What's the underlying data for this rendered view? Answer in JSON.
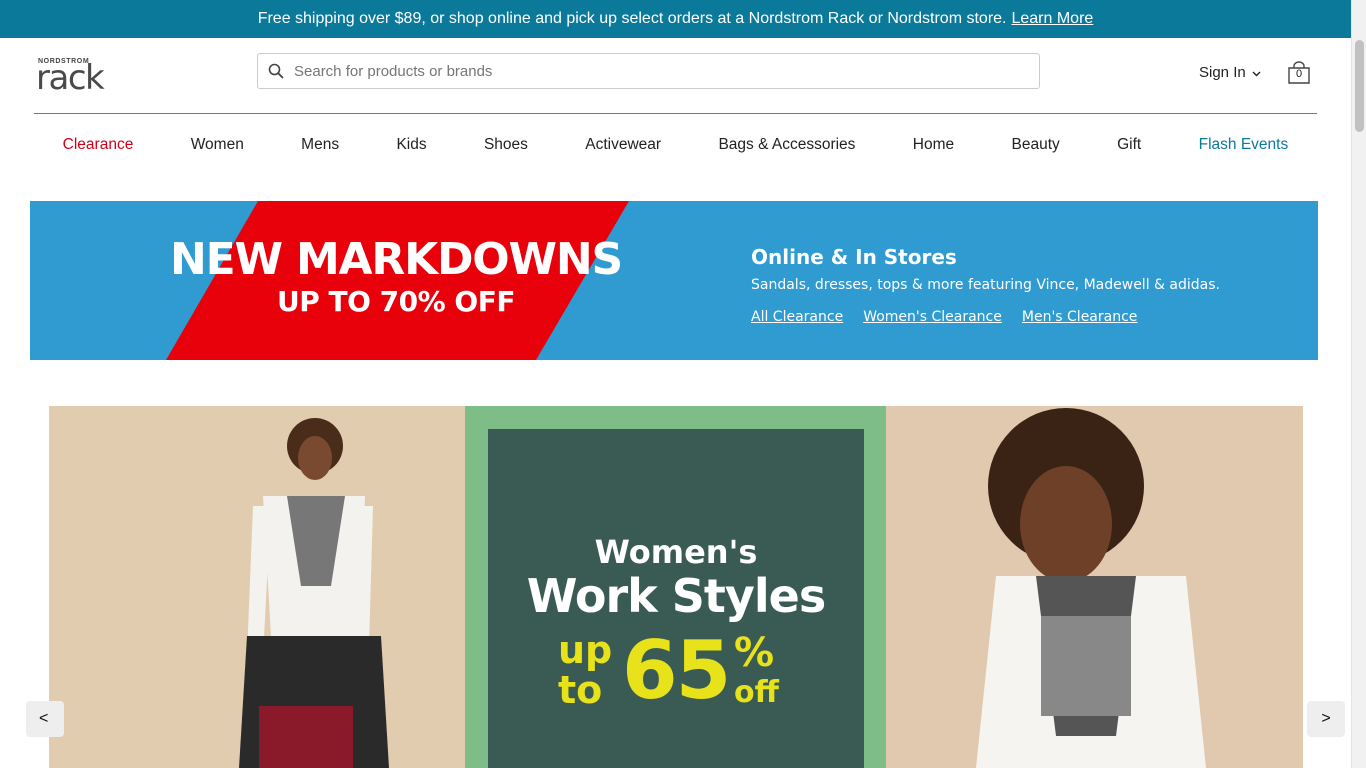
{
  "promo": {
    "text": "Free shipping over $89, or shop online and pick up select orders at a Nordstrom Rack or Nordstrom store.",
    "link": "Learn More"
  },
  "header": {
    "logo_small": "NORDSTROM",
    "logo_big": "rack",
    "search_placeholder": "Search for products or brands",
    "signin": "Sign In",
    "bag_count": "0"
  },
  "nav": {
    "items": [
      "Clearance",
      "Women",
      "Mens",
      "Kids",
      "Shoes",
      "Activewear",
      "Bags & Accessories",
      "Home",
      "Beauty",
      "Gift",
      "Flash Events"
    ]
  },
  "banner": {
    "title": "NEW MARKDOWNS",
    "subtitle": "UP TO 70% OFF",
    "headline": "Online & In Stores",
    "description": "Sandals, dresses, tops & more featuring Vince, Madewell & adidas.",
    "links": [
      "All Clearance",
      "Women's Clearance",
      "Men's Clearance"
    ]
  },
  "hero": {
    "line1": "Women's",
    "line2": "Work Styles",
    "up": "up",
    "to": "to",
    "number": "65",
    "percent": "%",
    "off": "off"
  },
  "carousel": {
    "prev": "<",
    "next": ">"
  },
  "colors": {
    "promo_bg": "#0b7a9a",
    "clearance": "#d0021b",
    "flash": "#0b7a9a",
    "banner_blue": "#2f9bd0",
    "banner_red": "#e8000b",
    "hero_green": "#7fbd88",
    "hero_dark": "#3a5a54",
    "hero_yellow": "#e8e21a"
  }
}
